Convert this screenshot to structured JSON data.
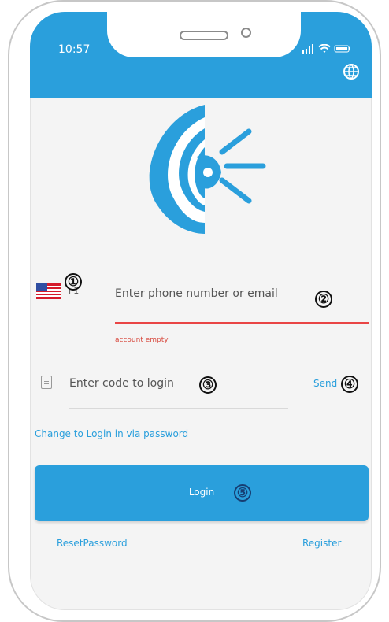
{
  "status_bar": {
    "time": "10:57"
  },
  "login_form": {
    "country_code": "+1",
    "account_placeholder": "Enter phone number or email",
    "account_error": "account empty",
    "code_placeholder": "Enter code to login",
    "send_label": "Send",
    "switch_login_label": "Change to Login in via password",
    "login_label": "Login",
    "reset_label": "ResetPassword",
    "register_label": "Register"
  },
  "annotations": {
    "one": "①",
    "two": "②",
    "three": "③",
    "four": "④",
    "five": "⑤"
  },
  "colors": {
    "accent": "#2a9fdc",
    "error": "#e94545"
  },
  "icons": [
    "globe-icon",
    "signal-icon",
    "wifi-icon",
    "battery-icon",
    "flag-icon",
    "code-icon",
    "brand-logo-icon"
  ]
}
